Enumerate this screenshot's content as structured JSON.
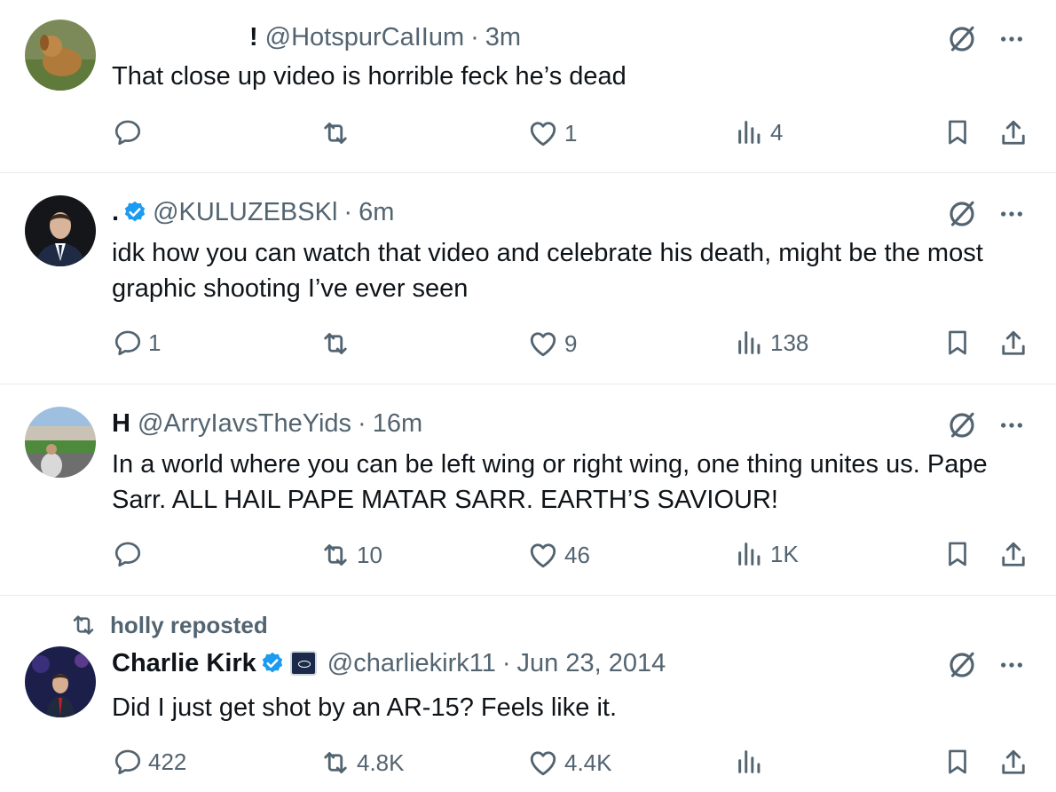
{
  "tweets": [
    {
      "name": "!",
      "handle": "@HotspurCaIIum",
      "time": "3m",
      "text": "That close up video is horrible feck he’s dead",
      "replies": "",
      "reposts": "",
      "likes": "1",
      "views": "4"
    },
    {
      "name": ".",
      "handle": "@KULUZEBSKl",
      "time": "6m",
      "text": "idk how you can watch that video and celebrate his death, might be the most graphic shooting I’ve ever seen",
      "replies": "1",
      "reposts": "",
      "likes": "9",
      "views": "138"
    },
    {
      "name": "H",
      "handle": "@ArryIavsTheYids",
      "time": "16m",
      "text": "In a world where you can be left wing or right wing, one thing unites us. Pape Sarr. ALL HAIL PAPE MATAR SARR. EARTH’S SAVIOUR!",
      "replies": "",
      "reposts": "10",
      "likes": "46",
      "views": "1K"
    },
    {
      "repost_label": "holly reposted",
      "name": "Charlie Kirk",
      "handle": "@charliekirk11",
      "time": "Jun 23, 2014",
      "text": "Did I just get shot by an AR-15? Feels like it.",
      "replies": "422",
      "reposts": "4.8K",
      "likes": "4.4K",
      "views": ""
    }
  ],
  "separator": "·",
  "colors": {
    "verified": "#1d9bf0",
    "muted": "#536471",
    "text": "#0f1419"
  }
}
